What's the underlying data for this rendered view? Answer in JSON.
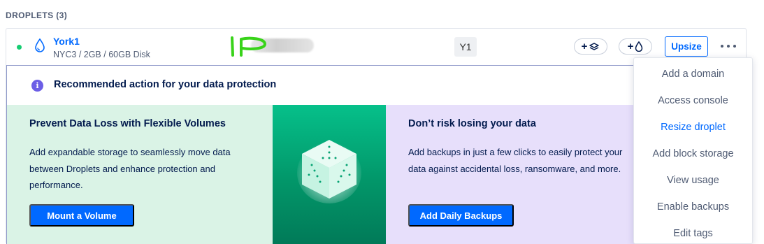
{
  "section": {
    "heading": "DROPLETS (3)"
  },
  "droplet": {
    "name": "York1",
    "specs": "NYC3 / 2GB / 60GB Disk",
    "tag": "Y1",
    "status_color": "#15cd72",
    "upsize_label": "Upsize",
    "add_volume_icon": "volume-icon",
    "add_backup_icon": "droplet-icon"
  },
  "recommendation": {
    "title": "Recommended action for your data protection",
    "info_icon": "i",
    "volumes": {
      "title": "Prevent Data Loss with Flexible Volumes",
      "body": "Add expandable storage to seamlessly move data between Droplets and enhance protection and performance.",
      "button": "Mount a Volume"
    },
    "backups": {
      "title": "Don’t risk losing your data",
      "body": "Add backups in just a few clicks to easily protect your data against accidental loss, ransomware, and more.",
      "button": "Add Daily Backups"
    }
  },
  "menu": {
    "items": [
      {
        "label": "Add a domain"
      },
      {
        "label": "Access console"
      },
      {
        "label": "Resize droplet"
      },
      {
        "label": "Add block storage"
      },
      {
        "label": "View usage"
      },
      {
        "label": "Enable backups"
      },
      {
        "label": "Edit tags"
      }
    ]
  },
  "colors": {
    "accent": "#0069ff",
    "volumes_bg": "#daf3e6",
    "backups_bg": "#e7dffb",
    "art_green": "#029669",
    "info_purple": "#6c5ee6"
  }
}
